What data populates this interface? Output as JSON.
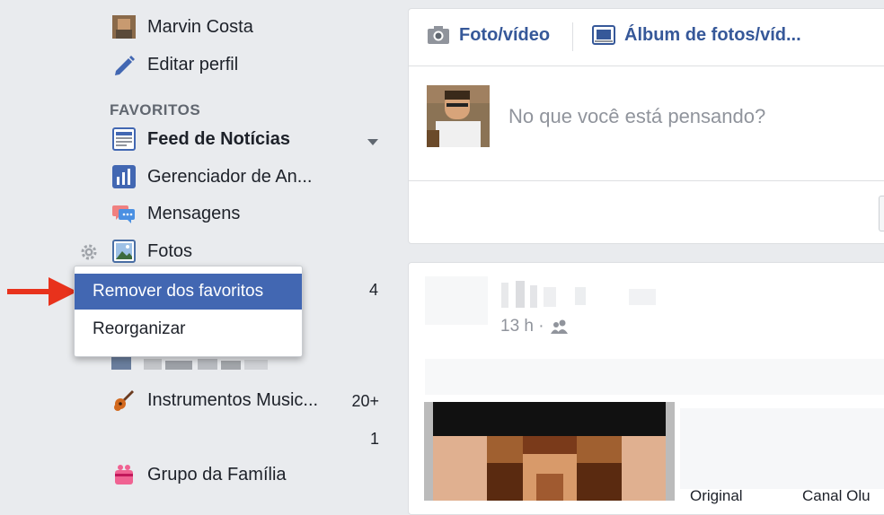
{
  "sidebar": {
    "profile_name": "Marvin Costa",
    "edit_profile": "Editar perfil",
    "favorites_title": "FAVORITOS",
    "items": [
      {
        "label": "Feed de Notícias"
      },
      {
        "label": "Gerenciador de An..."
      },
      {
        "label": "Mensagens"
      },
      {
        "label": "Fotos"
      },
      {
        "label": "Instrumentos Music...",
        "count": "20+"
      },
      {
        "label": "Grupo da Família"
      }
    ],
    "counts": {
      "row_four": "4",
      "row_one": "1"
    }
  },
  "context_menu": {
    "remove": "Remover dos favoritos",
    "reorganize": "Reorganizar"
  },
  "composer": {
    "photo_video": "Foto/vídeo",
    "album": "Álbum de fotos/víd...",
    "placeholder": "No que você está pensando?"
  },
  "post": {
    "time": "13 h ·"
  },
  "bottom_partial": {
    "left": "Original",
    "right": "Canal Olu"
  },
  "colors": {
    "accent": "#4267b2",
    "link": "#365899",
    "arrow": "#e8321c",
    "background": "#e9ebee"
  }
}
